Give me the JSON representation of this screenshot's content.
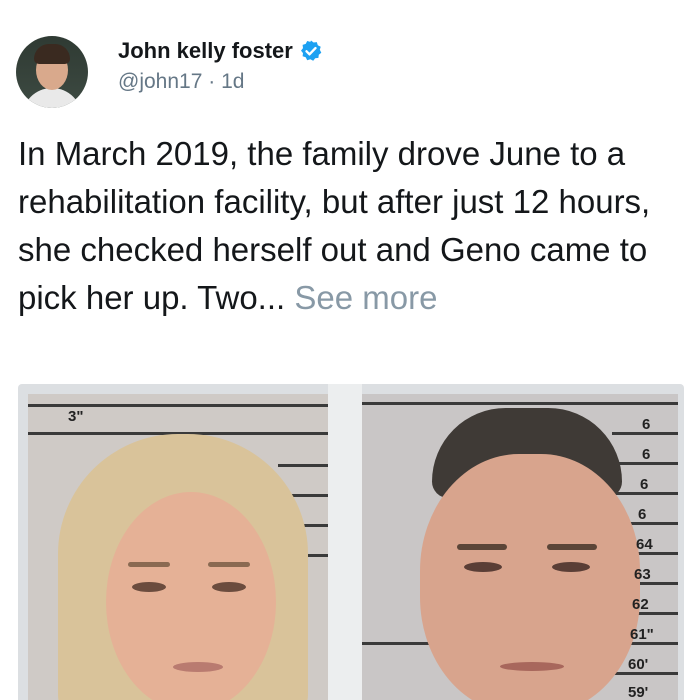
{
  "tweet": {
    "author": {
      "display_name": "John kelly foster",
      "handle": "@john17",
      "separator": "·",
      "time": "1d",
      "verified": true
    },
    "text": "In March 2019, the family drove June to a rehabilitation facility, but after just 12 hours, she checked herself out and Geno came to pick her up. Two...",
    "see_more_label": "See more"
  },
  "media": {
    "left_photo": {
      "height_labels": [
        "3\""
      ]
    },
    "right_photo": {
      "height_labels": [
        "6",
        "6",
        "6",
        "6",
        "64",
        "63",
        "62",
        "61\"",
        "60'",
        "59'"
      ]
    }
  },
  "colors": {
    "text": "#14171a",
    "muted": "#657786",
    "see_more": "#8899a6",
    "verified": "#1da1f2"
  }
}
